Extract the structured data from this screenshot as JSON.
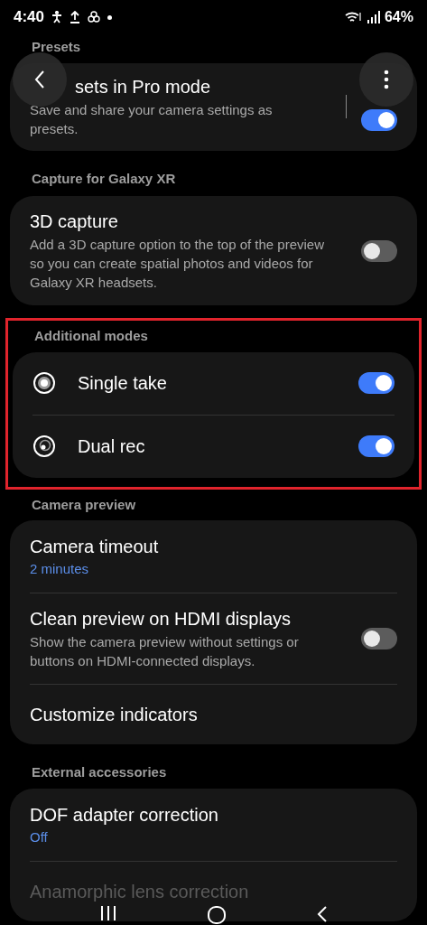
{
  "status_bar": {
    "time": "4:40",
    "battery": "64%"
  },
  "sections": [
    {
      "header": "Presets",
      "highlighted": false,
      "items": [
        {
          "kind": "split_toggle",
          "title": "sets in Pro mode",
          "description": "Save and share your camera settings as presets.",
          "on": true
        }
      ]
    },
    {
      "header": "Capture for Galaxy XR",
      "highlighted": false,
      "items": [
        {
          "kind": "toggle",
          "title": "3D capture",
          "description": "Add a 3D capture option to the top of the preview so you can create spatial photos and videos for Galaxy XR headsets.",
          "on": false
        }
      ]
    },
    {
      "header": "Additional modes",
      "highlighted": true,
      "items": [
        {
          "kind": "mode",
          "title": "Single take",
          "on": true
        },
        {
          "kind": "mode",
          "title": "Dual rec",
          "on": true
        }
      ]
    },
    {
      "header": "Camera preview",
      "highlighted": false,
      "items": [
        {
          "kind": "value",
          "title": "Camera timeout",
          "value": "2 minutes"
        },
        {
          "kind": "toggle",
          "title": "Clean preview on HDMI displays",
          "description": "Show the camera preview without settings or buttons on HDMI-connected displays.",
          "on": false
        },
        {
          "kind": "link",
          "title": "Customize indicators"
        }
      ]
    },
    {
      "header": "External accessories",
      "highlighted": false,
      "items": [
        {
          "kind": "value",
          "title": "DOF adapter correction",
          "value": "Off"
        },
        {
          "kind": "link",
          "title": "Anamorphic lens correction"
        }
      ]
    }
  ]
}
